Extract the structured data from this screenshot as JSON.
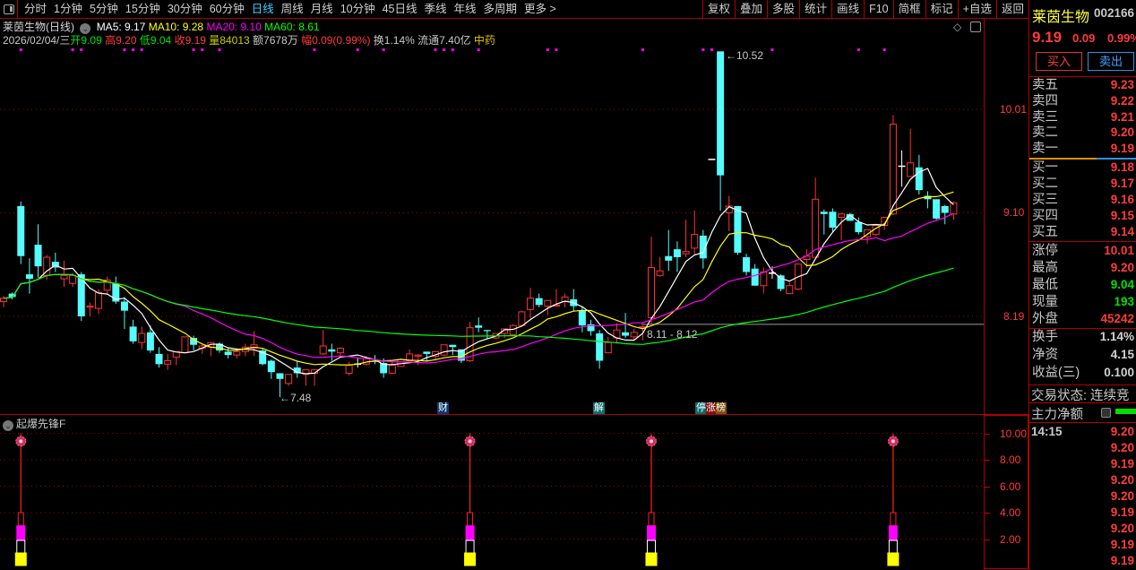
{
  "toolbar": {
    "periods": [
      "分时",
      "1分钟",
      "5分钟",
      "15分钟",
      "30分钟",
      "60分钟",
      "日线",
      "周线",
      "月线",
      "10分钟",
      "45日线",
      "季线",
      "年线",
      "多周期",
      "更多 >"
    ],
    "active_period": "日线",
    "buttons": [
      "复权",
      "叠加",
      "多股",
      "统计",
      "画线",
      "F10",
      "简框",
      "标记",
      "+自选",
      "返回"
    ]
  },
  "info": {
    "title": "莱茵生物(日线)",
    "ma5": "MA5: 9.17",
    "ma10": "MA10: 9.28",
    "ma20": "MA20: 9.10",
    "ma60": "MA60: 8.61",
    "date": "2026/02/04/三",
    "open_label": "开",
    "open": "9.09",
    "high_label": "高",
    "high": "9.20",
    "low_label": "低",
    "low": "9.04",
    "close_label": "收",
    "close": "9.19",
    "vol_label": "量",
    "vol": "84013",
    "amount": "额7678万",
    "change_label": "幅",
    "change": "0.09(0.99%)",
    "turnover": "换1.14%",
    "float_cap": "流通7.40亿",
    "sector": "中药"
  },
  "colors": {
    "up": "#ff3232",
    "down": "#54fcfc",
    "ma5": "#ffffff",
    "ma10": "#ffff00",
    "ma20": "#ff00ff",
    "ma60": "#00ff00",
    "grid": "#a00000",
    "accent": "#ff3b3b"
  },
  "chart_data": {
    "type": "candlestick",
    "price_axis_labels": [
      "10.01",
      "9.10",
      "8.19"
    ],
    "annotations": {
      "high": "10.52",
      "low": "7.48",
      "range": "8.11 - 8.12"
    },
    "events": [
      {
        "index": 50,
        "label": "财"
      },
      {
        "index": 68,
        "label": "解"
      },
      {
        "index": 81,
        "label": "停涨榜"
      }
    ],
    "top_markers": [
      2,
      8,
      9,
      14,
      15,
      16,
      22,
      23,
      25,
      36,
      41,
      44,
      50,
      51,
      52,
      55,
      63,
      64,
      74,
      81,
      82,
      89,
      99,
      102
    ],
    "ma_periods": [
      5,
      10,
      20,
      60
    ],
    "candles": [
      [
        8.32,
        8.37,
        8.27,
        8.35
      ],
      [
        8.39,
        8.4,
        8.34,
        8.36
      ],
      [
        9.16,
        9.2,
        8.65,
        8.72
      ],
      [
        8.56,
        8.7,
        8.39,
        8.52
      ],
      [
        8.82,
        9.0,
        8.53,
        8.63
      ],
      [
        8.55,
        8.73,
        8.51,
        8.71
      ],
      [
        8.67,
        8.75,
        8.58,
        8.62
      ],
      [
        8.52,
        8.68,
        8.45,
        8.55
      ],
      [
        8.48,
        8.57,
        8.45,
        8.55
      ],
      [
        8.56,
        8.58,
        8.15,
        8.19
      ],
      [
        8.27,
        8.31,
        8.19,
        8.28
      ],
      [
        8.26,
        8.43,
        8.21,
        8.4
      ],
      [
        8.42,
        8.54,
        8.39,
        8.51
      ],
      [
        8.48,
        8.54,
        8.3,
        8.32
      ],
      [
        8.32,
        8.36,
        8.08,
        8.24
      ],
      [
        8.1,
        8.16,
        7.95,
        7.97
      ],
      [
        7.96,
        8.1,
        7.9,
        8.04
      ],
      [
        8.05,
        8.11,
        7.87,
        7.89
      ],
      [
        7.86,
        7.92,
        7.74,
        7.77
      ],
      [
        7.77,
        7.86,
        7.72,
        7.8
      ],
      [
        7.83,
        7.88,
        7.76,
        7.88
      ],
      [
        7.87,
        8.01,
        7.87,
        8.01
      ],
      [
        8.0,
        8.02,
        7.89,
        7.94
      ],
      [
        7.91,
        7.94,
        7.86,
        7.93
      ],
      [
        7.92,
        7.96,
        7.84,
        7.96
      ],
      [
        7.95,
        7.96,
        7.87,
        7.89
      ],
      [
        7.88,
        7.91,
        7.82,
        7.85
      ],
      [
        7.85,
        7.91,
        7.82,
        7.88
      ],
      [
        7.88,
        7.95,
        7.84,
        7.92
      ],
      [
        7.91,
        8.06,
        7.84,
        7.94
      ],
      [
        7.89,
        7.91,
        7.76,
        7.77
      ],
      [
        7.8,
        7.81,
        7.64,
        7.7
      ],
      [
        7.69,
        7.69,
        7.48,
        7.64
      ],
      [
        7.6,
        7.68,
        7.58,
        7.68
      ],
      [
        7.74,
        7.8,
        7.65,
        7.69
      ],
      [
        7.68,
        7.72,
        7.58,
        7.72
      ],
      [
        7.69,
        7.72,
        7.58,
        7.72
      ],
      [
        7.86,
        8.07,
        7.85,
        7.93
      ],
      [
        7.9,
        7.95,
        7.8,
        7.88
      ],
      [
        7.87,
        7.92,
        7.84,
        7.91
      ],
      [
        7.69,
        7.79,
        7.67,
        7.76
      ],
      [
        7.77,
        7.82,
        7.74,
        7.77
      ],
      [
        7.77,
        7.84,
        7.76,
        7.82
      ],
      [
        7.8,
        7.85,
        7.77,
        7.79
      ],
      [
        7.78,
        7.82,
        7.65,
        7.69
      ],
      [
        7.69,
        7.8,
        7.69,
        7.76
      ],
      [
        7.75,
        7.82,
        7.75,
        7.81
      ],
      [
        7.8,
        7.9,
        7.8,
        7.86
      ],
      [
        7.84,
        7.86,
        7.76,
        7.85
      ],
      [
        7.88,
        7.88,
        7.8,
        7.86
      ],
      [
        7.84,
        7.88,
        7.8,
        7.88
      ],
      [
        7.85,
        7.94,
        7.84,
        7.94
      ],
      [
        7.94,
        7.94,
        7.85,
        7.92
      ],
      [
        7.9,
        7.9,
        7.78,
        7.8
      ],
      [
        7.8,
        8.14,
        7.79,
        8.09
      ],
      [
        8.11,
        8.18,
        8.05,
        8.09
      ],
      [
        8.07,
        8.07,
        7.99,
        8.06
      ],
      [
        8.0,
        8.04,
        7.99,
        8.04
      ],
      [
        8.04,
        8.08,
        8.0,
        8.08
      ],
      [
        8.03,
        8.12,
        8.02,
        8.11
      ],
      [
        8.11,
        8.24,
        8.11,
        8.23
      ],
      [
        8.25,
        8.44,
        8.17,
        8.35
      ],
      [
        8.35,
        8.39,
        8.27,
        8.29
      ],
      [
        8.28,
        8.33,
        8.2,
        8.33
      ],
      [
        8.28,
        8.43,
        8.28,
        8.29
      ],
      [
        8.32,
        8.39,
        8.27,
        8.36
      ],
      [
        8.34,
        8.43,
        8.24,
        8.28
      ],
      [
        8.24,
        8.28,
        8.05,
        8.11
      ],
      [
        8.12,
        8.16,
        8.02,
        8.06
      ],
      [
        8.04,
        8.07,
        7.73,
        7.8
      ],
      [
        7.87,
        8.01,
        7.87,
        7.96
      ],
      [
        8.0,
        8.13,
        7.95,
        8.07
      ],
      [
        8.05,
        8.22,
        8.0,
        8.02
      ],
      [
        8.01,
        8.08,
        7.98,
        8.05
      ],
      [
        8.09,
        8.11,
        7.98,
        8.1
      ],
      [
        8.18,
        8.89,
        8.12,
        8.62
      ],
      [
        8.55,
        8.71,
        8.54,
        8.59
      ],
      [
        8.72,
        8.95,
        8.59,
        8.68
      ],
      [
        8.78,
        8.85,
        8.58,
        8.71
      ],
      [
        8.74,
        9.04,
        8.71,
        8.76
      ],
      [
        8.79,
        9.12,
        8.73,
        8.91
      ],
      [
        8.9,
        8.95,
        8.61,
        8.7
      ],
      [
        9.57,
        9.57,
        9.57,
        9.57
      ],
      [
        10.52,
        10.52,
        9.12,
        9.43
      ],
      [
        9.1,
        9.25,
        8.94,
        9.16
      ],
      [
        9.16,
        9.16,
        8.73,
        8.75
      ],
      [
        8.71,
        8.74,
        8.55,
        8.58
      ],
      [
        8.61,
        8.65,
        8.46,
        8.46
      ],
      [
        8.46,
        8.62,
        8.39,
        8.58
      ],
      [
        8.57,
        8.63,
        8.52,
        8.57
      ],
      [
        8.55,
        8.56,
        8.41,
        8.43
      ],
      [
        8.39,
        8.49,
        8.39,
        8.46
      ],
      [
        8.43,
        8.65,
        8.42,
        8.65
      ],
      [
        8.69,
        8.78,
        8.62,
        8.72
      ],
      [
        8.71,
        9.41,
        8.71,
        9.22
      ],
      [
        9.11,
        9.13,
        8.91,
        9.09
      ],
      [
        9.11,
        9.14,
        8.93,
        8.97
      ],
      [
        9.06,
        9.1,
        8.86,
        9.09
      ],
      [
        9.09,
        9.1,
        9.03,
        9.03
      ],
      [
        9.02,
        9.06,
        8.91,
        8.93
      ],
      [
        8.89,
        8.95,
        8.83,
        8.95
      ],
      [
        8.91,
        8.99,
        8.9,
        8.99
      ],
      [
        8.99,
        9.06,
        8.95,
        9.06
      ],
      [
        9.09,
        9.96,
        9.08,
        9.88
      ],
      [
        9.51,
        9.65,
        9.33,
        9.51
      ],
      [
        9.42,
        9.84,
        9.42,
        9.54
      ],
      [
        9.5,
        9.61,
        9.26,
        9.3
      ],
      [
        9.25,
        9.29,
        9.14,
        9.22
      ],
      [
        9.22,
        9.22,
        9.04,
        9.05
      ],
      [
        9.16,
        9.17,
        9.0,
        9.1
      ],
      [
        9.09,
        9.2,
        9.04,
        9.19
      ]
    ]
  },
  "indicator": {
    "title": "起爆先锋F",
    "axis_labels": [
      "10.00",
      "8.00",
      "6.00",
      "4.00",
      "2.00"
    ],
    "axis_values": [
      10,
      8,
      6,
      4,
      2
    ],
    "signal_indices": [
      2,
      54,
      75,
      103
    ],
    "signal_line_top": 10.0,
    "signal_icon_level": 9.4,
    "bars": [
      {
        "from": 3.0,
        "to": 4.0,
        "color": "#ff2020",
        "filled": false
      },
      {
        "from": 1.9,
        "to": 3.0,
        "color": "#ff00ff",
        "filled": true
      },
      {
        "from": 0.95,
        "to": 1.9,
        "color": "#ffffff",
        "filled": false
      },
      {
        "from": 0,
        "to": 0.95,
        "color": "#ffff00",
        "filled": true
      }
    ]
  },
  "quote": {
    "name": "莱茵生物",
    "code": "002166",
    "price": "9.19",
    "change": "0.09",
    "change_pct": "0.99%",
    "buy_label": "买入",
    "sell_label": "卖出",
    "asks": [
      {
        "label": "卖五",
        "price": "9.23"
      },
      {
        "label": "卖四",
        "price": "9.22"
      },
      {
        "label": "卖三",
        "price": "9.21"
      },
      {
        "label": "卖二",
        "price": "9.20"
      },
      {
        "label": "卖一",
        "price": "9.19"
      }
    ],
    "bids": [
      {
        "label": "买一",
        "price": "9.18"
      },
      {
        "label": "买二",
        "price": "9.17"
      },
      {
        "label": "买三",
        "price": "9.16"
      },
      {
        "label": "买四",
        "price": "9.15"
      },
      {
        "label": "买五",
        "price": "9.14"
      }
    ],
    "stats": [
      {
        "label": "涨停",
        "value": "10.01",
        "color": "#ff3b3b"
      },
      {
        "label": "最高",
        "value": "9.20",
        "color": "#ff3b3b"
      },
      {
        "label": "最低",
        "value": "9.04",
        "color": "#00e000"
      },
      {
        "label": "现量",
        "value": "193",
        "color": "#00e000"
      },
      {
        "label": "外盘",
        "value": "45242",
        "color": "#ff3b3b"
      }
    ],
    "stats2": [
      {
        "label": "换手",
        "value": "1.14%"
      },
      {
        "label": "净资",
        "value": "4.15"
      },
      {
        "label": "收益(三)",
        "value": "0.100"
      }
    ],
    "trade_status": "交易状态: 连续竞",
    "main_flow_label": "主力净额",
    "ticks_time": "14:15",
    "ticks": [
      "9.20",
      "9.20",
      "9.19",
      "9.20",
      "9.20",
      "9.19",
      "9.20",
      "9.19",
      "9.19"
    ]
  }
}
